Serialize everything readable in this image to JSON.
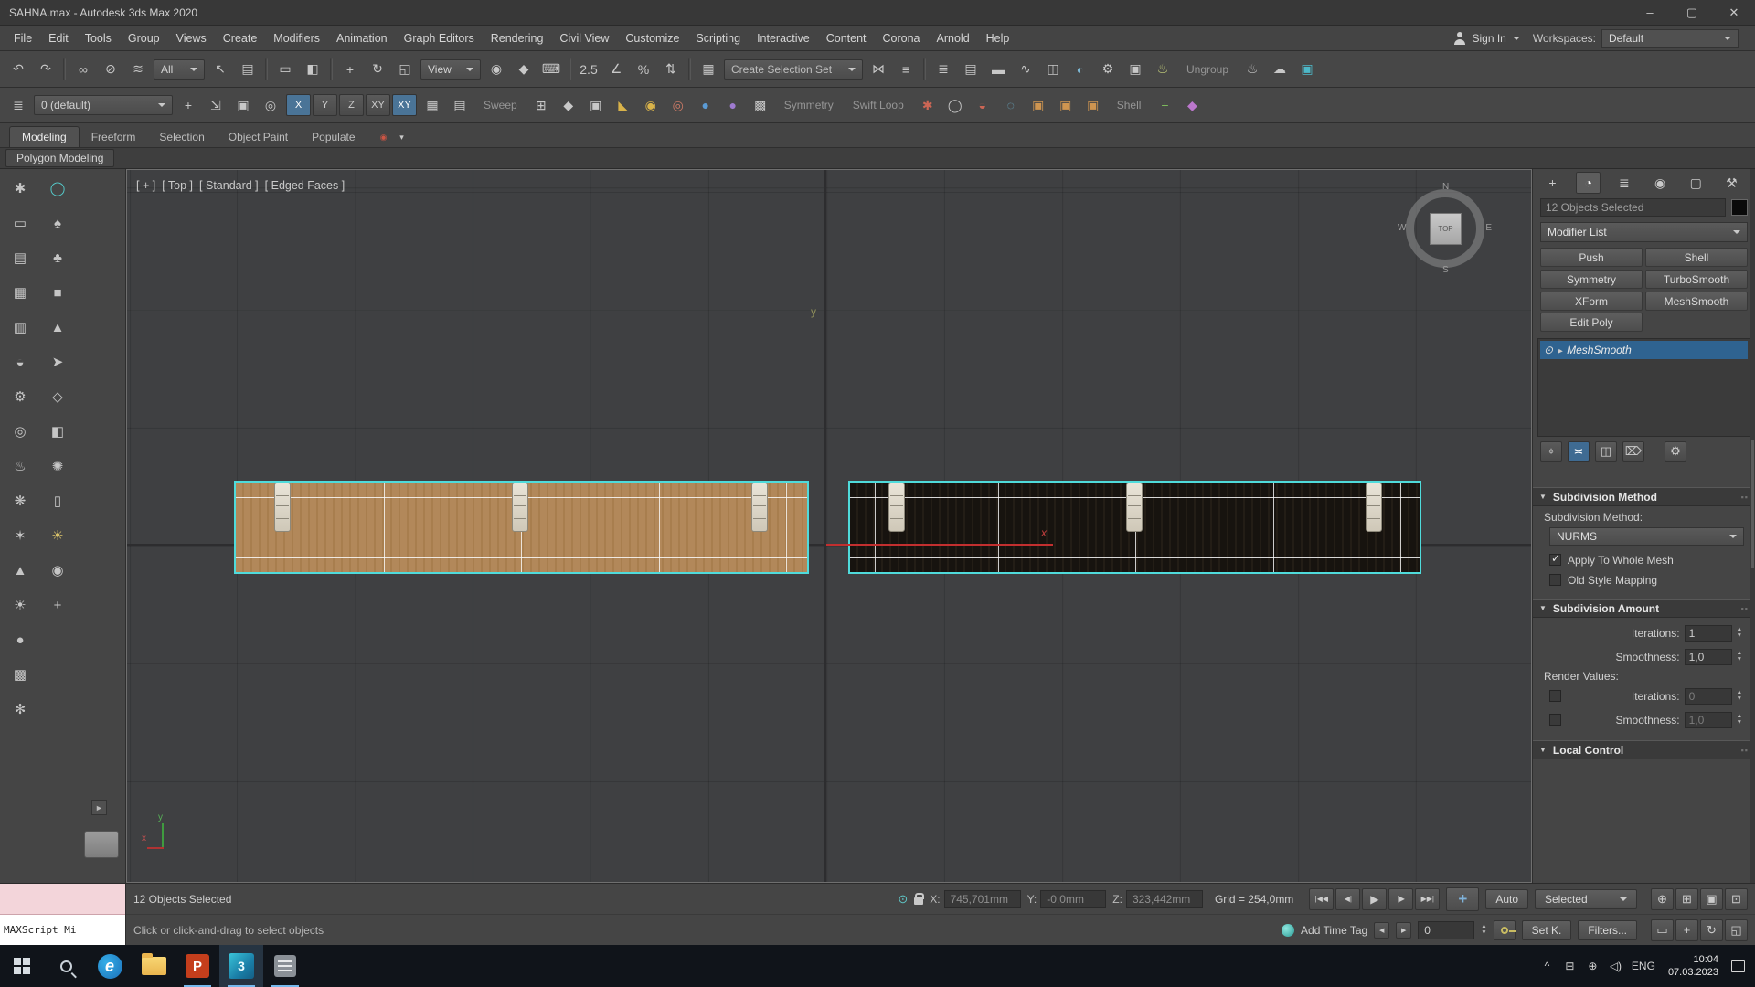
{
  "titlebar": {
    "title": "SAHNA.max - Autodesk 3ds Max 2020",
    "minimize": "–",
    "maximize": "▢",
    "close": "✕"
  },
  "menubar": {
    "items": [
      "File",
      "Edit",
      "Tools",
      "Group",
      "Views",
      "Create",
      "Modifiers",
      "Animation",
      "Graph Editors",
      "Rendering",
      "Civil View",
      "Customize",
      "Scripting",
      "Interactive",
      "Content",
      "Corona",
      "Arnold",
      "Help"
    ],
    "sign_in": "Sign In",
    "workspaces_label": "Workspaces:",
    "workspaces_value": "Default"
  },
  "toolbar1": {
    "g1": [
      {
        "name": "undo-icon",
        "g": "↶"
      },
      {
        "name": "redo-icon",
        "g": "↷"
      },
      {
        "state": "sep"
      },
      {
        "name": "select-and-link-icon",
        "g": "∞"
      },
      {
        "name": "unlink-selection-icon",
        "g": "⊘"
      },
      {
        "name": "bind-to-space-warp-icon",
        "g": "≋"
      }
    ],
    "filter_value": "All",
    "g2": [
      {
        "name": "select-object-icon",
        "g": "↖"
      },
      {
        "name": "select-by-name-icon",
        "g": "▤"
      },
      {
        "state": "sep"
      },
      {
        "name": "rectangular-selection-icon",
        "g": "▭"
      },
      {
        "name": "window-crossing-icon",
        "g": "◧"
      },
      {
        "state": "sep"
      },
      {
        "name": "select-and-move-icon",
        "g": "+"
      },
      {
        "name": "select-and-rotate-icon",
        "g": "↻"
      },
      {
        "name": "select-and-scale-icon",
        "g": "◱"
      }
    ],
    "coord_value": "View",
    "g3": [
      {
        "name": "use-pivot-center-icon",
        "g": "◉"
      },
      {
        "name": "select-and-manipulate-icon",
        "g": "◆"
      },
      {
        "name": "keyboard-override-icon",
        "g": "⌨"
      },
      {
        "state": "sep"
      },
      {
        "name": "snaps-toggle-icon",
        "g": "2.5"
      },
      {
        "name": "angle-snap-icon",
        "g": "∠"
      },
      {
        "name": "percent-snap-icon",
        "g": "%"
      },
      {
        "name": "spinner-snap-icon",
        "g": "⇅"
      },
      {
        "state": "sep"
      },
      {
        "name": "edit-named-selection-sets-icon",
        "g": "▦"
      }
    ],
    "selection_set_value": "Create Selection Set",
    "g4": [
      {
        "name": "mirror-icon",
        "g": "⋈"
      },
      {
        "name": "align-icon",
        "g": "≡"
      },
      {
        "state": "sep"
      },
      {
        "name": "scene-explorer-icon",
        "g": "≣"
      },
      {
        "name": "layer-explorer-icon",
        "g": "▤"
      },
      {
        "name": "ribbon-toggle-icon",
        "g": "▬"
      },
      {
        "name": "curve-editor-icon",
        "g": "∿"
      },
      {
        "name": "schematic-view-icon",
        "g": "◫"
      },
      {
        "name": "material-editor-icon",
        "g": "◐",
        "c": "#7db8d4"
      },
      {
        "name": "render-setup-icon",
        "g": "⚙"
      },
      {
        "name": "rendered-frame-icon",
        "g": "▣"
      },
      {
        "name": "render-production-icon",
        "g": "♨",
        "c": "#c9d47d"
      }
    ],
    "ungroup_label": "Ungroup",
    "g5": [
      {
        "name": "render-iterative-icon",
        "g": "♨"
      },
      {
        "name": "cloud-render-icon",
        "g": "☁"
      },
      {
        "name": "teal-tool-icon",
        "g": "▣",
        "c": "#4db8c8"
      }
    ]
  },
  "toolbar2": {
    "g0": [
      {
        "name": "modifier-stack-icon",
        "g": "≣"
      }
    ],
    "layer_value": "0 (default)",
    "layer_tools": [
      {
        "name": "create-layer-icon",
        "g": "+"
      },
      {
        "name": "add-selection-to-layer-icon",
        "g": "⇲"
      },
      {
        "name": "select-objects-in-layer-icon",
        "g": "▣"
      },
      {
        "name": "set-current-layer-icon",
        "g": "◎"
      }
    ],
    "constraints": [
      {
        "label": "X",
        "state": "active"
      },
      {
        "label": "Y"
      },
      {
        "label": "Z"
      },
      {
        "label": "XY"
      },
      {
        "label": "XY",
        "state": "active"
      }
    ],
    "g1": [
      {
        "name": "make-planar-icon",
        "g": "▦"
      },
      {
        "name": "view-align-icon",
        "g": "▤"
      }
    ],
    "sweep_label": "Sweep",
    "g2": [
      {
        "name": "extrude-icon",
        "g": "⊞"
      },
      {
        "name": "bevel-icon",
        "g": "◆"
      },
      {
        "name": "inset-icon",
        "g": "▣"
      },
      {
        "name": "chamfer-icon",
        "g": "◣",
        "c": "#d9b34a"
      },
      {
        "name": "weld-icon",
        "g": "◉",
        "c": "#d9b34a"
      },
      {
        "name": "target-weld-icon",
        "g": "◎",
        "c": "#cc7a66"
      },
      {
        "name": "blue-sphere-icon",
        "g": "●",
        "c": "#5b9bd5"
      },
      {
        "name": "purple-sphere-icon",
        "g": "●",
        "c": "#9f7bd0"
      },
      {
        "name": "checker-icon",
        "g": "▩"
      }
    ],
    "symmetry_label": "Symmetry",
    "swift_loop_label": "Swift Loop",
    "g3": [
      {
        "name": "paint-deform-icon",
        "g": "✱",
        "c": "#cc6655"
      },
      {
        "name": "relax-icon",
        "g": "◯"
      },
      {
        "name": "conform-brush-icon",
        "g": "◒",
        "c": "#cc6655"
      }
    ],
    "g4": [
      {
        "name": "soft-selection-icon",
        "g": "◌",
        "c": "#6ab0cc"
      },
      {
        "name": "edit-geometry-icon",
        "g": "▣",
        "c": "#cf9550"
      },
      {
        "name": "detach-icon",
        "g": "▣",
        "c": "#cf9550"
      },
      {
        "name": "attach-icon",
        "g": "▣",
        "c": "#cf9550"
      }
    ],
    "shell_label": "Shell",
    "g5": [
      {
        "name": "quad-chamfer-icon",
        "g": "+",
        "c": "#7cb85c"
      },
      {
        "name": "gem-tool-icon",
        "g": "◆",
        "c": "#bb77cc"
      }
    ]
  },
  "ribbon": {
    "tabs": [
      {
        "label": "Modeling",
        "state": "active"
      },
      {
        "label": "Freeform"
      },
      {
        "label": "Selection"
      },
      {
        "label": "Object Paint"
      },
      {
        "label": "Populate"
      }
    ],
    "extras": [
      {
        "name": "ribbon-media-icon",
        "g": "◉",
        "c": "#cc5544"
      },
      {
        "name": "ribbon-caret-icon",
        "g": "▾"
      }
    ],
    "subtab": "Polygon Modeling"
  },
  "dock": {
    "col1": [
      {
        "name": "paint-tool-icon",
        "g": "✱"
      },
      {
        "name": "plane-icon",
        "g": "▭"
      },
      {
        "name": "sheet-icon",
        "g": "▤"
      },
      {
        "name": "grid-icon",
        "g": "▦"
      },
      {
        "name": "cylinder-icon",
        "g": "▥"
      },
      {
        "name": "lathe-icon",
        "g": "◒"
      },
      {
        "name": "gear-icon",
        "g": "⚙"
      },
      {
        "name": "torus-icon",
        "g": "◎"
      },
      {
        "name": "teapot-icon",
        "g": "♨"
      },
      {
        "name": "scatter-icon",
        "g": "❋"
      },
      {
        "name": "star-icon",
        "g": "✶"
      },
      {
        "name": "cone-icon",
        "g": "▲"
      },
      {
        "name": "sun-icon",
        "g": "☀"
      },
      {
        "name": "sphere-icon",
        "g": "●"
      },
      {
        "name": "pattern-icon",
        "g": "▩"
      },
      {
        "name": "snowflake-icon",
        "g": "✻"
      }
    ],
    "col2": [
      {
        "name": "circle-gizmo-icon",
        "g": "◯",
        "c": "#55cccc"
      },
      {
        "name": "tree-icon",
        "g": "♠"
      },
      {
        "name": "foliage-icon",
        "g": "♣"
      },
      {
        "name": "box-icon",
        "g": "■"
      },
      {
        "name": "pyramid-icon",
        "g": "▲"
      },
      {
        "name": "arrow-icon",
        "g": "➤"
      },
      {
        "name": "polygon-icon",
        "g": "◇"
      },
      {
        "name": "cube-icon",
        "g": "◧"
      },
      {
        "name": "spray-icon",
        "g": "✺"
      },
      {
        "name": "panel-icon",
        "g": "▯"
      },
      {
        "name": "lamp-icon",
        "g": "☀",
        "c": "#d9c26a"
      },
      {
        "name": "camera-icon",
        "g": "◉"
      },
      {
        "name": "helper-icon",
        "g": "+"
      }
    ],
    "flyout": "►"
  },
  "viewport": {
    "label_segments": [
      "[ + ]",
      "[ Top ]",
      "[ Standard ]",
      "[ Edged Faces ]"
    ],
    "viewcube": {
      "n": "N",
      "s": "S",
      "e": "E",
      "w": "W",
      "top": "TOP"
    },
    "gizmo_x_label": "x",
    "gizmo_y_label": "y",
    "tripod_x": "x",
    "tripod_y": "y"
  },
  "cmd_panel": {
    "tabs": [
      {
        "name": "create-tab-icon",
        "g": "+"
      },
      {
        "name": "modify-tab-icon",
        "g": "◔",
        "state": "active"
      },
      {
        "name": "hierarchy-tab-icon",
        "g": "≣"
      },
      {
        "name": "motion-tab-icon",
        "g": "◉"
      },
      {
        "name": "display-tab-icon",
        "g": "▢"
      },
      {
        "name": "utilities-tab-icon",
        "g": "⚒"
      }
    ],
    "selection_label": "12 Objects Selected",
    "modifier_list_label": "Modifier List",
    "modifier_buttons": [
      "Push",
      "Shell",
      "Symmetry",
      "TurboSmooth",
      "XForm",
      "MeshSmooth"
    ],
    "edit_poly_label": "Edit Poly",
    "stack": [
      {
        "label": "MeshSmooth",
        "state": "selected"
      }
    ],
    "stack_tools": [
      {
        "name": "pin-stack-icon",
        "g": "⌖"
      },
      {
        "name": "show-end-result-icon",
        "g": "≍",
        "state": "active"
      },
      {
        "name": "make-unique-icon",
        "g": "◫"
      },
      {
        "name": "remove-modifier-icon",
        "g": "⌦"
      },
      {
        "name": "configure-modifier-sets-icon",
        "g": "⚙"
      }
    ],
    "rollouts": {
      "subdivision_method": {
        "title": "Subdivision Method",
        "method_label": "Subdivision Method:",
        "method_value": "NURMS",
        "apply_whole_mesh": {
          "label": "Apply To Whole Mesh",
          "checked": true
        },
        "old_style": {
          "label": "Old Style Mapping",
          "checked": false
        }
      },
      "subdivision_amount": {
        "title": "Subdivision Amount",
        "iterations_label": "Iterations:",
        "iterations_value": "1",
        "smoothness_label": "Smoothness:",
        "smoothness_value": "1,0",
        "render_values_label": "Render Values:",
        "render_iterations": {
          "label": "Iterations:",
          "value": "0",
          "checked": false
        },
        "render_smoothness": {
          "label": "Smoothness:",
          "value": "1,0",
          "checked": false
        }
      },
      "local_control": {
        "title": "Local Control"
      }
    }
  },
  "statusbar": {
    "selection_count": "12 Objects Selected",
    "prompt": "Click or click-and-drag to select objects",
    "maxscript": "MAXScript Mi",
    "x_label": "X:",
    "x_value": "745,701mm",
    "y_label": "Y:",
    "y_value": "-0,0mm",
    "z_label": "Z:",
    "z_value": "323,442mm",
    "grid_label": "Grid = 254,0mm",
    "playback": [
      {
        "name": "go-to-start-button",
        "g": "|◀◀"
      },
      {
        "name": "previous-frame-button",
        "g": "◀|"
      },
      {
        "name": "play-button",
        "g": "▶",
        "state": "play"
      },
      {
        "name": "next-frame-button",
        "g": "|▶"
      },
      {
        "name": "go-to-end-button",
        "g": "▶▶|"
      }
    ],
    "auto_label": "Auto",
    "selected_label": "Selected",
    "set_key_label": "Set K.",
    "filters_label": "Filters...",
    "add_time_tag": "Add Time Tag",
    "frame_value": "0",
    "nav_row1": [
      {
        "name": "zoom-icon",
        "g": "⊕"
      },
      {
        "name": "zoom-all-icon",
        "g": "⊞"
      },
      {
        "name": "zoom-extents-icon",
        "g": "▣"
      },
      {
        "name": "zoom-extents-all-icon",
        "g": "⊡"
      }
    ],
    "nav_row2": [
      {
        "name": "zoom-region-icon",
        "g": "▭"
      },
      {
        "name": "pan-icon",
        "g": "+"
      },
      {
        "name": "orbit-icon",
        "g": "↻"
      },
      {
        "name": "maximize-viewport-icon",
        "g": "◱"
      }
    ]
  },
  "taskbar": {
    "edge_letter": "e",
    "powerpoint_letter": "P",
    "max_letter": "3",
    "lang": "ENG",
    "time": "10:04",
    "date": "07.03.2023",
    "tray_chevron": "^",
    "tray_net": "⊟",
    "tray_globe": "⊕",
    "tray_volume": "◁)"
  }
}
